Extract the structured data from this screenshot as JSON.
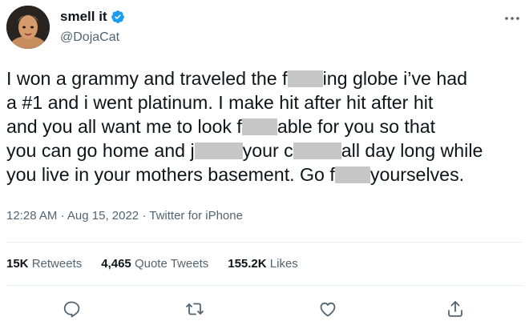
{
  "author": {
    "display_name": "smell it",
    "handle": "@DojaCat",
    "avatar_icon": "avatar-photo",
    "verified_icon": "verified-badge-icon",
    "verified_color": "#1d9bf0"
  },
  "tweet": {
    "lines": [
      [
        "I won a grammy and traveled the f",
        "[censored]",
        "ing globe i’ve had"
      ],
      [
        "a #1 and i went platinum. I make hit after hit after hit"
      ],
      [
        "and you all want me to look f",
        "[censored]",
        "able for you so that"
      ],
      [
        "you can go home and j",
        "[censored]",
        "your c",
        "[censored]",
        "all day long while"
      ],
      [
        "you live in your mothers basement. Go f",
        "[censored]",
        "yourselves."
      ]
    ],
    "censor_color": "#c6c6c6"
  },
  "meta": {
    "time": "12:28 AM",
    "separator": "·",
    "date": "Aug 15, 2022",
    "source": "Twitter for iPhone"
  },
  "stats": {
    "retweets_count": "15K",
    "retweets_label": "Retweets",
    "quotes_count": "4,465",
    "quotes_label": "Quote Tweets",
    "likes_count": "155.2K",
    "likes_label": "Likes"
  },
  "actions": [
    "reply-icon",
    "retweet-icon",
    "like-icon",
    "share-icon"
  ],
  "more_icon": "more-options-icon",
  "colors": {
    "text": "#0f1419",
    "secondary": "#536471",
    "divider": "#e6ecf0"
  }
}
